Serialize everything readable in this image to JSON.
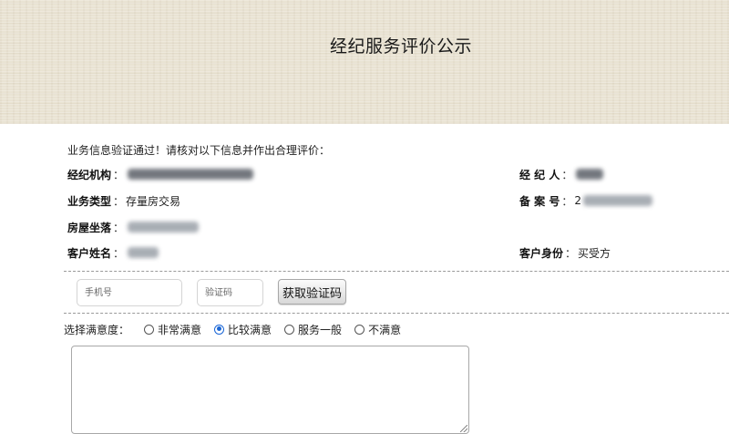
{
  "page": {
    "title": "经纪服务评价公示",
    "notice": "业务信息验证通过！请核对以下信息并作出合理评价："
  },
  "info": {
    "agency": {
      "label": "经纪机构",
      "sep": "："
    },
    "agent": {
      "label": "经 纪 人",
      "sep": "："
    },
    "business_type": {
      "label": "业务类型",
      "sep": "：",
      "value": "存量房交易"
    },
    "record_no": {
      "label": "备 案 号",
      "sep": "：",
      "value_prefix": "2"
    },
    "location": {
      "label": "房屋坐落",
      "sep": "："
    },
    "customer_name": {
      "label": "客户姓名",
      "sep": "："
    },
    "customer_role": {
      "label": "客户身份",
      "sep": "：",
      "value": "买受方"
    }
  },
  "verify": {
    "phone_placeholder": "手机号",
    "code_placeholder": "验证码",
    "get_code_label": "获取验证码"
  },
  "rating": {
    "label": "选择满意度：",
    "options": [
      "非常满意",
      "比较满意",
      "服务一般",
      "不满意"
    ],
    "selected": "比较满意"
  },
  "colors": {
    "radio_checked": "#1a66d6",
    "header_bg": "#e9e3d3"
  }
}
